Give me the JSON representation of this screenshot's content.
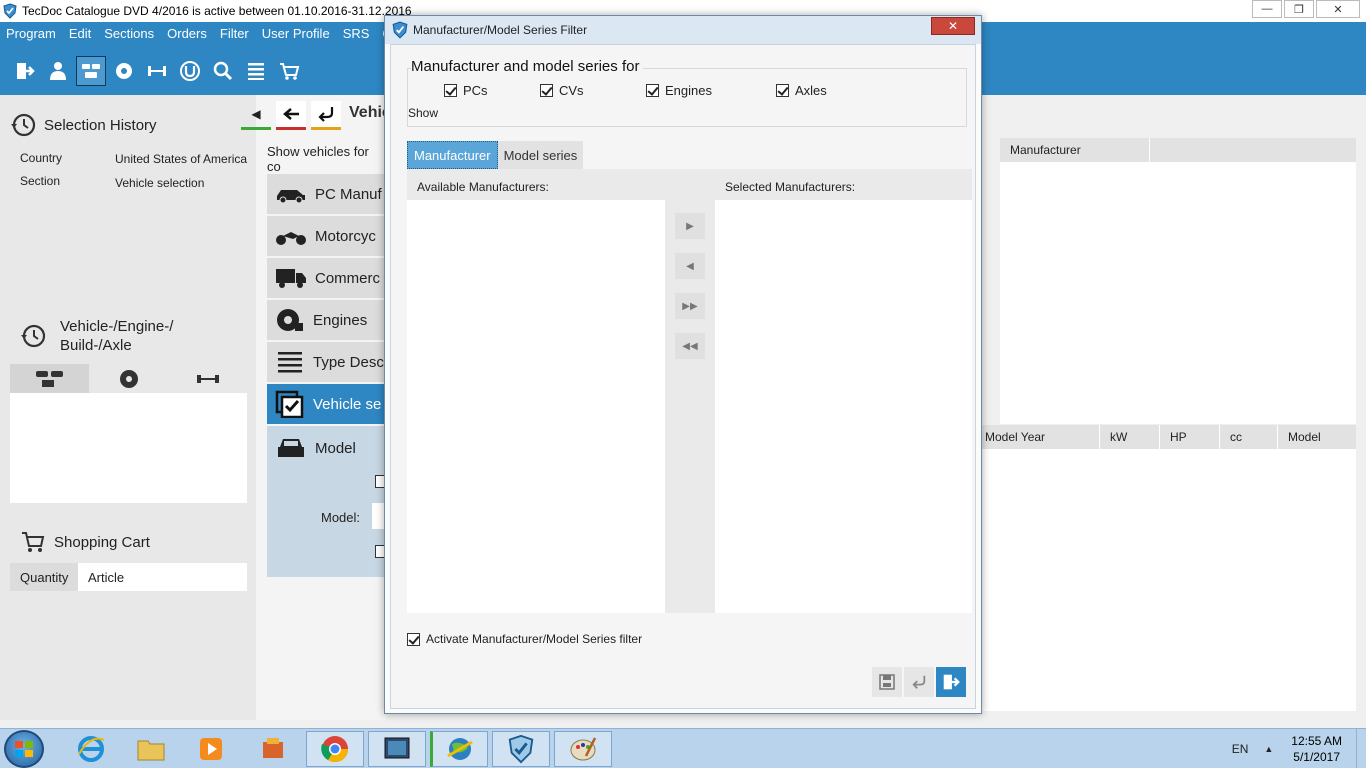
{
  "window": {
    "title": "TecDoc Catalogue DVD   4/2016 is active between 01.10.2016-31.12.2016",
    "controls": {
      "minimize": "—",
      "maximize": "❐",
      "close": "✕"
    }
  },
  "menu": [
    "Program",
    "Edit",
    "Sections",
    "Orders",
    "Filter",
    "User Profile",
    "SRS",
    "CA"
  ],
  "toolbar_icons": [
    "exit-icon",
    "user-icon",
    "vehicles-icon",
    "engine-icon",
    "axle-icon",
    "universal-icon",
    "search-icon",
    "list-icon",
    "cart-icon"
  ],
  "left": {
    "selection_history": {
      "title": "Selection History",
      "rows": [
        {
          "key": "Country",
          "value": "United States of America"
        },
        {
          "key": "Section",
          "value": "Vehicle selection"
        }
      ]
    },
    "vehicle_history": {
      "title_line1": "Vehicle-/Engine-/",
      "title_line2": "Build-/Axle"
    },
    "shopping_cart": {
      "title": "Shopping Cart",
      "col_quantity": "Quantity",
      "col_article": "Article"
    }
  },
  "middle": {
    "heading": "Vehic",
    "show_text": "Show vehicles for co",
    "categories": [
      {
        "label": "PC Manuf",
        "icon": "car-icon"
      },
      {
        "label": "Motorcyc",
        "icon": "motorcycle-icon"
      },
      {
        "label": "Commerc",
        "icon": "truck-icon"
      },
      {
        "label": "Engines",
        "icon": "engine-icon"
      },
      {
        "label": "Type Desc",
        "icon": "list-icon"
      },
      {
        "label": "Vehicle se",
        "icon": "check-icon"
      },
      {
        "label": "Model",
        "icon": "car-front-icon"
      }
    ],
    "model_label": "Model:"
  },
  "right": {
    "top_header": [
      "Manufacturer"
    ],
    "bottom_header": [
      "Model Year",
      "kW",
      "HP",
      "cc",
      "Model"
    ]
  },
  "dialog": {
    "title": "Manufacturer/Model Series Filter",
    "close": "✕",
    "group_title": "Manufacturer and model series for",
    "checkboxes": [
      {
        "label": "PCs",
        "checked": true
      },
      {
        "label": "CVs",
        "checked": true
      },
      {
        "label": "Engines",
        "checked": true
      },
      {
        "label": "Axles",
        "checked": true
      }
    ],
    "show_label": "Show",
    "tabs": [
      {
        "label": "Manufacturer",
        "active": true
      },
      {
        "label": "Model series",
        "active": false
      }
    ],
    "available_label": "Available Manufacturers:",
    "selected_label": "Selected Manufacturers:",
    "arrows": [
      "▶",
      "◀",
      "▶▶",
      "◀◀"
    ],
    "activate_label": "Activate Manufacturer/Model Series filter",
    "activate_checked": true
  },
  "taskbar": {
    "language": "EN",
    "time": "12:55 AM",
    "date": "5/1/2017"
  }
}
